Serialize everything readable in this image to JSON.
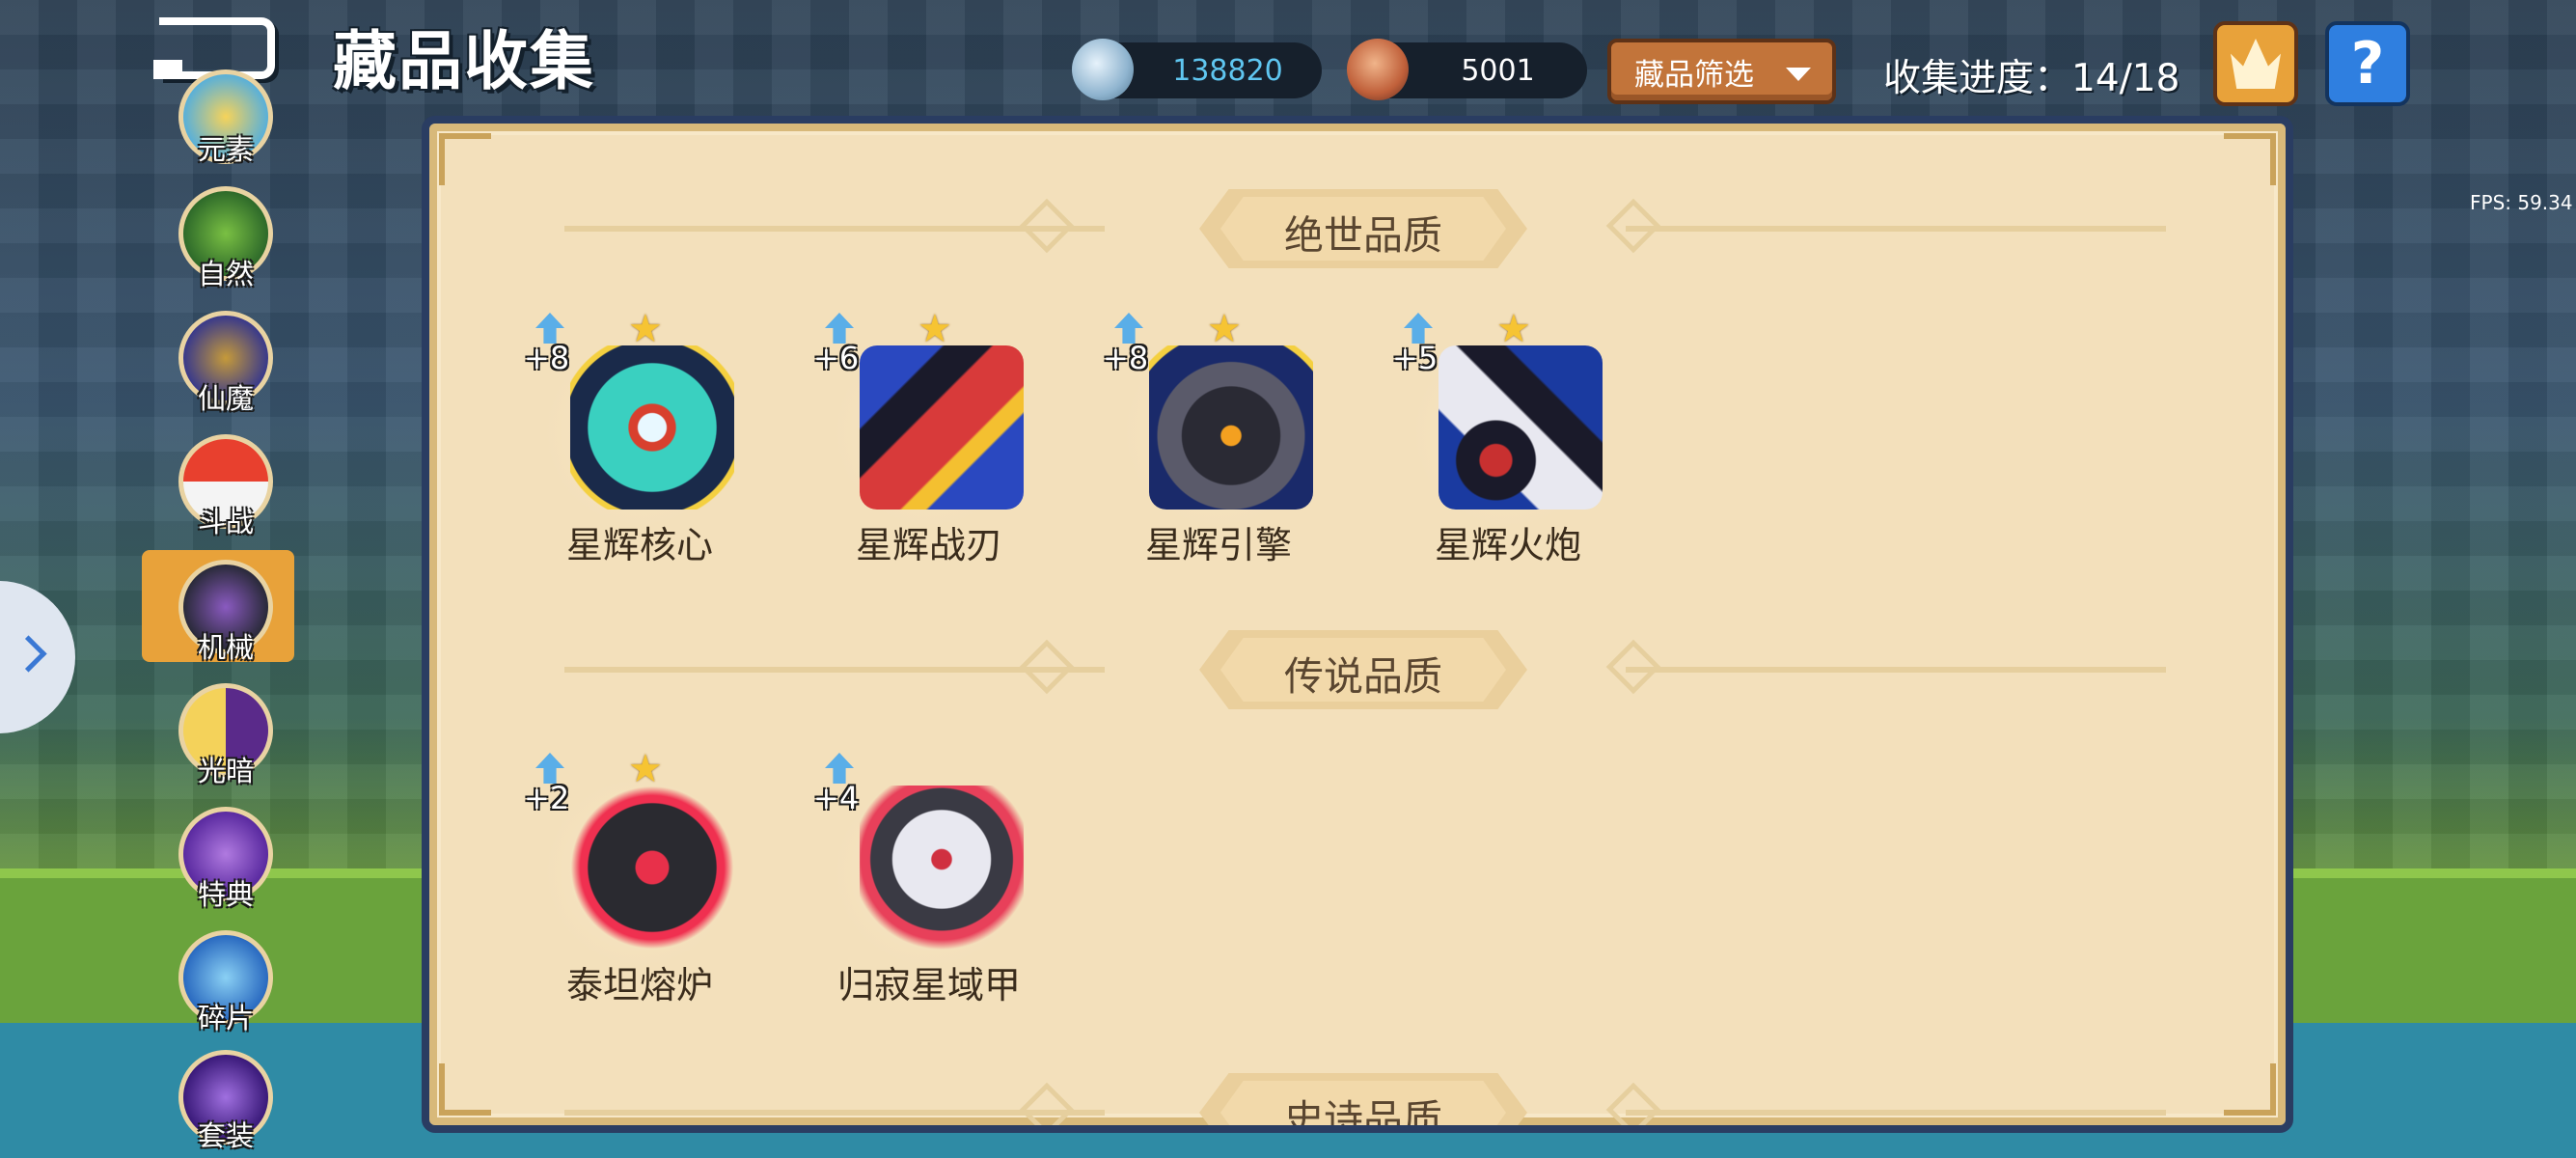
{
  "header": {
    "title": "藏品收集",
    "currency": [
      {
        "icon": "crystal-orb-icon",
        "value": "138820"
      },
      {
        "icon": "ore-icon",
        "value": "5001"
      }
    ],
    "filter_label": "藏品筛选",
    "progress_label": "收集进度：14/18",
    "fps": "FPS: 59.34"
  },
  "sidebar": {
    "active": "机械",
    "items": [
      {
        "label": "元素",
        "icon": "element-icon"
      },
      {
        "label": "自然",
        "icon": "tree-icon"
      },
      {
        "label": "仙魔",
        "icon": "demon-icon"
      },
      {
        "label": "斗战",
        "icon": "battle-ball-icon"
      },
      {
        "label": "机械",
        "icon": "mech-icon"
      },
      {
        "label": "光暗",
        "icon": "light-dark-icon"
      },
      {
        "label": "特典",
        "icon": "book-icon"
      },
      {
        "label": "碎片",
        "icon": "puzzle-icon"
      },
      {
        "label": "套装",
        "icon": "set-icon"
      }
    ]
  },
  "sections": [
    {
      "title": "绝世品质",
      "items": [
        {
          "name": "星辉核心",
          "level": "+8",
          "icon": "star-core-icon"
        },
        {
          "name": "星辉战刃",
          "level": "+6",
          "icon": "star-blade-icon"
        },
        {
          "name": "星辉引擎",
          "level": "+8",
          "icon": "star-engine-icon"
        },
        {
          "name": "星辉火炮",
          "level": "+5",
          "icon": "star-cannon-icon"
        }
      ]
    },
    {
      "title": "传说品质",
      "items": [
        {
          "name": "泰坦熔炉",
          "level": "+2",
          "icon": "titan-furnace-icon"
        },
        {
          "name": "归寂星域甲",
          "level": "+4",
          "icon": "star-armor-icon"
        }
      ]
    },
    {
      "title": "史诗品质",
      "items": []
    }
  ],
  "colors": {
    "panel": "#f3e0bb",
    "panel_border": "#2a3d62",
    "accent": "#e8a23a",
    "star": "#f6c433",
    "level_arrow": "#5aaee8"
  }
}
